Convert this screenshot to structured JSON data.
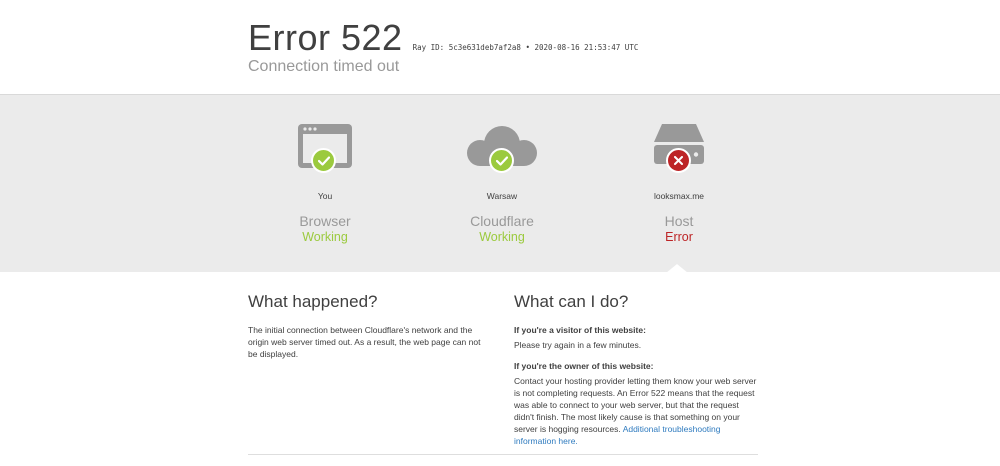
{
  "header": {
    "error_title": "Error 522",
    "ray_info": "Ray ID: 5c3e631deb7af2a8 • 2020-08-16 21:53:47 UTC",
    "subtitle": "Connection timed out"
  },
  "nodes": [
    {
      "place": "You",
      "kind": "Browser",
      "state": "Working",
      "icon": "browser-window-icon",
      "badge": "check-icon"
    },
    {
      "place": "Warsaw",
      "kind": "Cloudflare",
      "state": "Working",
      "icon": "cloud-icon",
      "badge": "check-icon"
    },
    {
      "place": "looksmax.me",
      "kind": "Host",
      "state": "Error",
      "icon": "server-icon",
      "badge": "x-icon"
    }
  ],
  "colors": {
    "working": "#9bca3e",
    "error": "#bd2426",
    "link": "#2f7bbf",
    "band": "#ebebeb"
  },
  "what_happened": {
    "heading": "What happened?",
    "body": "The initial connection between Cloudflare's network and the origin web server timed out. As a result, the web page can not be displayed."
  },
  "what_can_i_do": {
    "heading": "What can I do?",
    "visitor_lead": "If you're a visitor of this website:",
    "visitor_body": "Please try again in a few minutes.",
    "owner_lead": "If you're the owner of this website:",
    "owner_body": "Contact your hosting provider letting them know your web server is not completing requests. An Error 522 means that the request was able to connect to your web server, but that the request didn't finish. The most likely cause is that something on your server is hogging resources.",
    "link_text": "Additional troubleshooting information here."
  }
}
